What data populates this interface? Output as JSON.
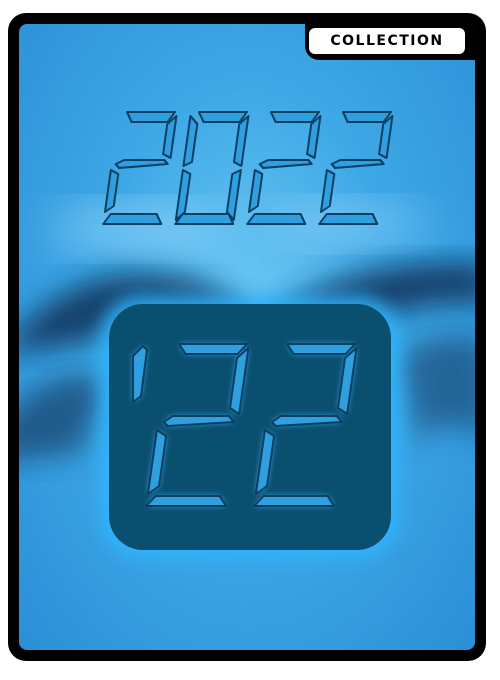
{
  "badge": {
    "label": "COLLECTION"
  },
  "artwork": {
    "year_full": "2022",
    "year_short": "'22"
  },
  "colors": {
    "background": "#3ea8e6",
    "digit_fill": "#2f9fe0",
    "digit_outline": "#0a3f63",
    "tile": "#0b4f70",
    "tile_glow": "#2fb6ff"
  }
}
